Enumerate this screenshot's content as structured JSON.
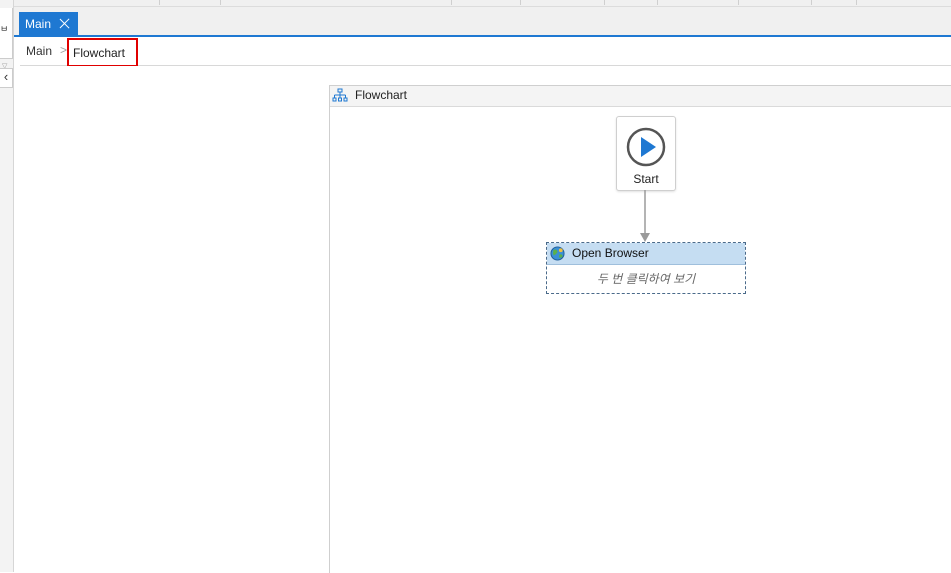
{
  "tab_bar": {
    "active_tab": {
      "label": "Main",
      "close_icon": "close-icon"
    }
  },
  "breadcrumb": {
    "root": "Main",
    "separator": ">",
    "current": "Flowchart"
  },
  "designer": {
    "flowchart": {
      "title": "Flowchart",
      "icon": "flowchart-icon",
      "start_node": {
        "label": "Start",
        "icon": "play-icon"
      },
      "activities": [
        {
          "title": "Open Browser",
          "hint": "두 번 클릭하여 보기",
          "icon": "globe-icon"
        }
      ]
    }
  },
  "colors": {
    "accent": "#1e78d2",
    "highlight_box": "#e00000",
    "activity_header": "#c5ddf2",
    "play": "#1e78d2"
  }
}
